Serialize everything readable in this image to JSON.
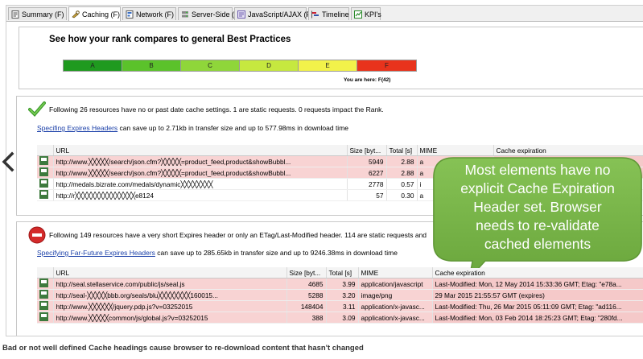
{
  "tabs": [
    {
      "label": "Summary (F)",
      "icon": "summary-icon",
      "active": false
    },
    {
      "label": "Caching (F)",
      "icon": "caching-icon",
      "active": true
    },
    {
      "label": "Network (F)",
      "icon": "network-icon",
      "active": false
    },
    {
      "label": "Server-Side (F)",
      "icon": "server-side-icon",
      "active": false
    },
    {
      "label": "JavaScript/AJAX (F)",
      "icon": "javascript-icon",
      "active": false
    },
    {
      "label": "Timeline",
      "icon": "timeline-icon",
      "active": false
    },
    {
      "label": "KPI's",
      "icon": "kpi-icon",
      "active": false
    }
  ],
  "rank": {
    "title": "See how your rank compares to general Best Practices",
    "grades": [
      "A",
      "B",
      "C",
      "D",
      "E",
      "F"
    ],
    "grade_colors": [
      "#1f9a1f",
      "#5bc22b",
      "#8fd63a",
      "#c6e83f",
      "#f2f24a",
      "#e8331c"
    ],
    "current_grade": "F",
    "you_are_here": "You are here: F(42)"
  },
  "section1": {
    "status_icon": "check-icon",
    "summary": "Following 26 resources have no or past date cache settings. 1 are static requests. 0 requests impact the Rank.",
    "link": "Specifing Expires Headers",
    "savings": "can save up to 2.71kb in transfer size and up to 577.98ms in download time",
    "columns": [
      "URL",
      "Size [byt...",
      "Total [s]",
      "MIME",
      "Cache expiration"
    ],
    "rows": [
      {
        "url": "http://www.╳╳╳╳╳/search/json.cfm?╳╳╳╳╳=product_feed,product&showBubbl...",
        "size": "5949",
        "total": "2.88",
        "mime": "a",
        "cache": "",
        "style": "pink"
      },
      {
        "url": "http://www.╳╳╳╳╳/search/json.cfm?╳╳╳╳╳=product_feed,product&showBubbl...",
        "size": "6227",
        "total": "2.88",
        "mime": "a",
        "cache": "",
        "style": "pink"
      },
      {
        "url": "http://medals.bizrate.com/medals/dynamic╳╳╳╳╳╳╳╳",
        "size": "2778",
        "total": "0.57",
        "mime": "i",
        "cache": "",
        "style": "white"
      },
      {
        "url": "http://r╳╳╳╳╳╳╳╳╳╳╳╳╳╳╳e8124",
        "size": "57",
        "total": "0.30",
        "mime": "a",
        "cache": "",
        "style": "white"
      }
    ]
  },
  "section2": {
    "status_icon": "no-entry-icon",
    "summary": "Following 149 resources have a very short Expires header or only an ETag/Last-Modified header. 114 are static requests and",
    "link": "Specifying Far-Future Expires Headers",
    "savings": "can save up to 285.65kb in transfer size and up to 9246.38ms in download time",
    "columns": [
      "URL",
      "Size [byt...",
      "Total [s]",
      "MIME",
      "Cache expiration"
    ],
    "rows": [
      {
        "url": "http://seal.stellaservice.com/public/js/seal.js",
        "size": "4685",
        "total": "3.99",
        "mime": "application/javascript",
        "cache": "Last-Modified: Mon, 12 May 2014 15:33:36 GMT; Etag: \"e78a...",
        "style": "pink"
      },
      {
        "url": "http://seal-╳╳╳╳╳bbb.org/seals/blu╳╳╳╳╳╳╳╳160015...",
        "size": "5288",
        "total": "3.20",
        "mime": "image/png",
        "cache": "29 Mar 2015 21:55:57 GMT (expires)",
        "style": "pink"
      },
      {
        "url": "http://www.╳╳╳╳╳╳/jquery.pdp.js?v=03252015",
        "size": "148404",
        "total": "3.11",
        "mime": "application/x-javasc...",
        "cache": "Last-Modified: Thu, 26 Mar 2015 05:11:09 GMT; Etag: \"ad116...",
        "style": "pink"
      },
      {
        "url": "http://www.╳╳╳╳╳common/js/global.js?v=03252015",
        "size": "388",
        "total": "3.09",
        "mime": "application/x-javasc...",
        "cache": "Last-Modified: Mon, 03 Feb 2014 18:25:23 GMT; Etag: \"280fd...",
        "style": "pink"
      }
    ]
  },
  "callout": {
    "lines": [
      "Most elements have no",
      "explicit Cache Expiration",
      "Header set. Browser",
      "needs to re-validate",
      "cached elements"
    ],
    "color": "#7ab648"
  },
  "caption": "Bad or not well defined Cache headings cause browser to re-download content that hasn't changed"
}
